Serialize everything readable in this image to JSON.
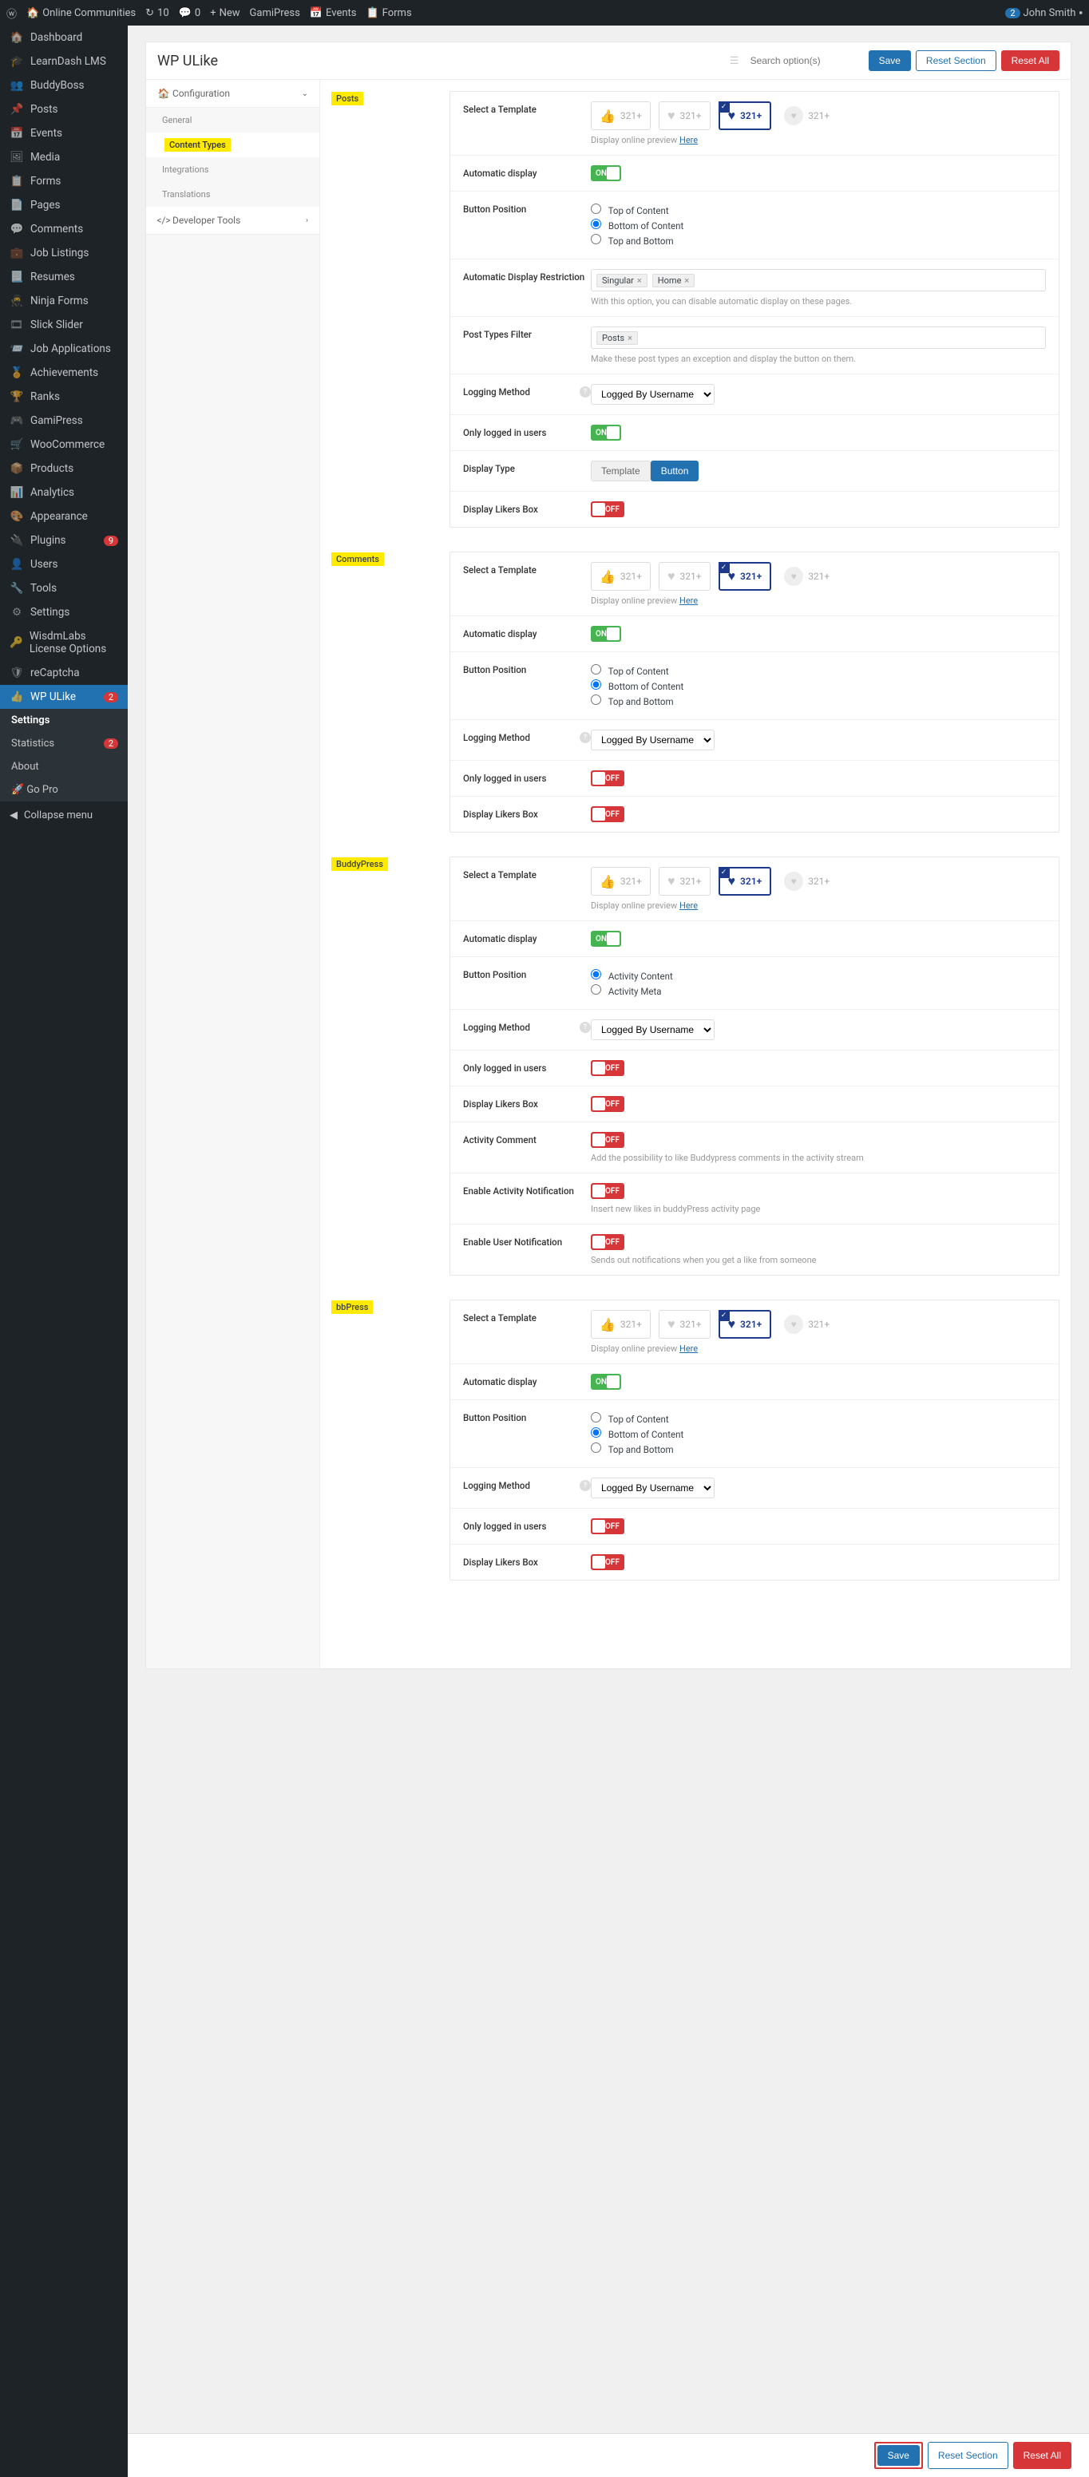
{
  "adminbar": {
    "site": "Online Communities",
    "updates": "10",
    "comments": "0",
    "new": "New",
    "items": [
      "GamiPress",
      "Events",
      "Forms"
    ],
    "user_badge": "2",
    "user": "John Smith"
  },
  "sidebar": {
    "items": [
      {
        "label": "Dashboard",
        "icon": "🏠"
      },
      {
        "label": "LearnDash LMS",
        "icon": "🎓"
      },
      {
        "label": "BuddyBoss",
        "icon": "👥"
      },
      {
        "label": "Posts",
        "icon": "📌"
      },
      {
        "label": "Events",
        "icon": "📅"
      },
      {
        "label": "Media",
        "icon": "🖼"
      },
      {
        "label": "Forms",
        "icon": "📋"
      },
      {
        "label": "Pages",
        "icon": "📄"
      },
      {
        "label": "Comments",
        "icon": "💬"
      },
      {
        "label": "Job Listings",
        "icon": "💼"
      },
      {
        "label": "Resumes",
        "icon": "📃"
      },
      {
        "label": "Ninja Forms",
        "icon": "🥷"
      },
      {
        "label": "Slick Slider",
        "icon": "🎞"
      },
      {
        "label": "Job Applications",
        "icon": "📨"
      },
      {
        "label": "Achievements",
        "icon": "🏅"
      },
      {
        "label": "Ranks",
        "icon": "🏆"
      },
      {
        "label": "GamiPress",
        "icon": "🎮"
      },
      {
        "label": "WooCommerce",
        "icon": "🛒"
      },
      {
        "label": "Products",
        "icon": "📦"
      },
      {
        "label": "Analytics",
        "icon": "📊"
      },
      {
        "label": "Appearance",
        "icon": "🎨"
      },
      {
        "label": "Plugins",
        "icon": "🔌",
        "badge": "9"
      },
      {
        "label": "Users",
        "icon": "👤"
      },
      {
        "label": "Tools",
        "icon": "🔧"
      },
      {
        "label": "Settings",
        "icon": "⚙"
      },
      {
        "label": "WisdmLabs License Options",
        "icon": "🔑"
      },
      {
        "label": "reCaptcha",
        "icon": "🛡"
      },
      {
        "label": "WP ULike",
        "icon": "👍",
        "badge": "2",
        "current": true
      }
    ],
    "submenu": [
      {
        "label": "Settings",
        "current": true
      },
      {
        "label": "Statistics",
        "badge": "2"
      },
      {
        "label": "About"
      },
      {
        "label": "Go Pro",
        "rocket": true
      }
    ],
    "collapse": "Collapse menu"
  },
  "page": {
    "title": "WP ULike",
    "search_placeholder": "Search option(s)",
    "save": "Save",
    "reset_section": "Reset Section",
    "reset_all": "Reset All"
  },
  "tabs": {
    "config": "Configuration",
    "general": "General",
    "content_types": "Content Types",
    "integrations": "Integrations",
    "translations": "Translations",
    "dev_tools": "Developer Tools"
  },
  "common": {
    "select_template": "Select a Template",
    "template_count": "321+",
    "preview_text": "Display online preview ",
    "preview_link": "Here",
    "auto_display": "Automatic display",
    "button_position": "Button Position",
    "auto_restriction": "Automatic Display Restriction",
    "restriction_help": "With this option, you can disable automatic display on these pages.",
    "post_types_filter": "Post Types Filter",
    "post_types_help": "Make these post types an exception and display the button on them.",
    "logging_method": "Logging Method",
    "logging_select": "Logged By Username",
    "only_logged": "Only logged in users",
    "display_likers": "Display Likers Box",
    "display_type": "Display Type",
    "template_label": "Template",
    "button_label": "Button",
    "activity_comment": "Activity Comment",
    "activity_comment_help": "Add the possibility to like Buddypress comments in the activity stream",
    "enable_activity_notif": "Enable Activity Notification",
    "enable_activity_notif_help": "Insert new likes in buddyPress activity page",
    "enable_user_notif": "Enable User Notification",
    "enable_user_notif_help": "Sends out notifications when you get a like from someone",
    "on": "ON",
    "off": "OFF",
    "restriction_tags": [
      "Singular",
      "Home"
    ],
    "posts_tag": "Posts",
    "pos_top": "Top of Content",
    "pos_bottom": "Bottom of Content",
    "pos_both": "Top and Bottom",
    "pos_act_content": "Activity Content",
    "pos_act_meta": "Activity Meta"
  },
  "sections": [
    {
      "label": "Posts",
      "id": "posts"
    },
    {
      "label": "Comments",
      "id": "comments"
    },
    {
      "label": "BuddyPress",
      "id": "bp"
    },
    {
      "label": "bbPress",
      "id": "bb"
    }
  ]
}
